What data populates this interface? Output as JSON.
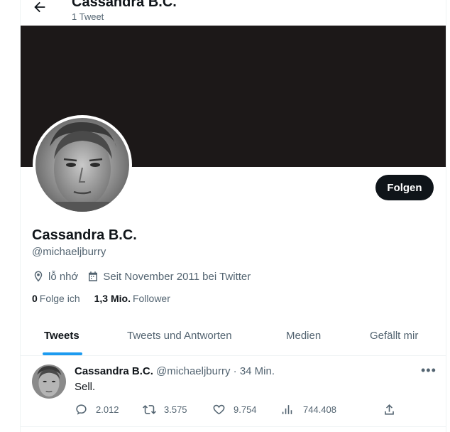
{
  "header": {
    "title": "Cassandra B.C.",
    "tweet_count": "1 Tweet"
  },
  "profile": {
    "name": "Cassandra B.C.",
    "handle": "@michaeljburry",
    "location": "lỗ nhớ",
    "joined": "Seit November 2011 bei Twitter",
    "following_count": "0",
    "following_label": "Folge ich",
    "followers_count": "1,3 Mio.",
    "followers_label": "Follower",
    "follow_button": "Folgen"
  },
  "tabs": [
    {
      "label": "Tweets",
      "active": true
    },
    {
      "label": "Tweets und Antworten",
      "active": false
    },
    {
      "label": "Medien",
      "active": false
    },
    {
      "label": "Gefällt mir",
      "active": false
    }
  ],
  "tweet": {
    "author_name": "Cassandra B.C.",
    "author_handle": "@michaeljburry",
    "separator": "·",
    "time": "34 Min.",
    "text": "Sell.",
    "replies": "2.012",
    "retweets": "3.575",
    "likes": "9.754",
    "views": "744.408"
  },
  "colors": {
    "accent": "#1d9bf0",
    "banner": "#1c1818",
    "text": "#0f1419",
    "muted": "#536471"
  }
}
